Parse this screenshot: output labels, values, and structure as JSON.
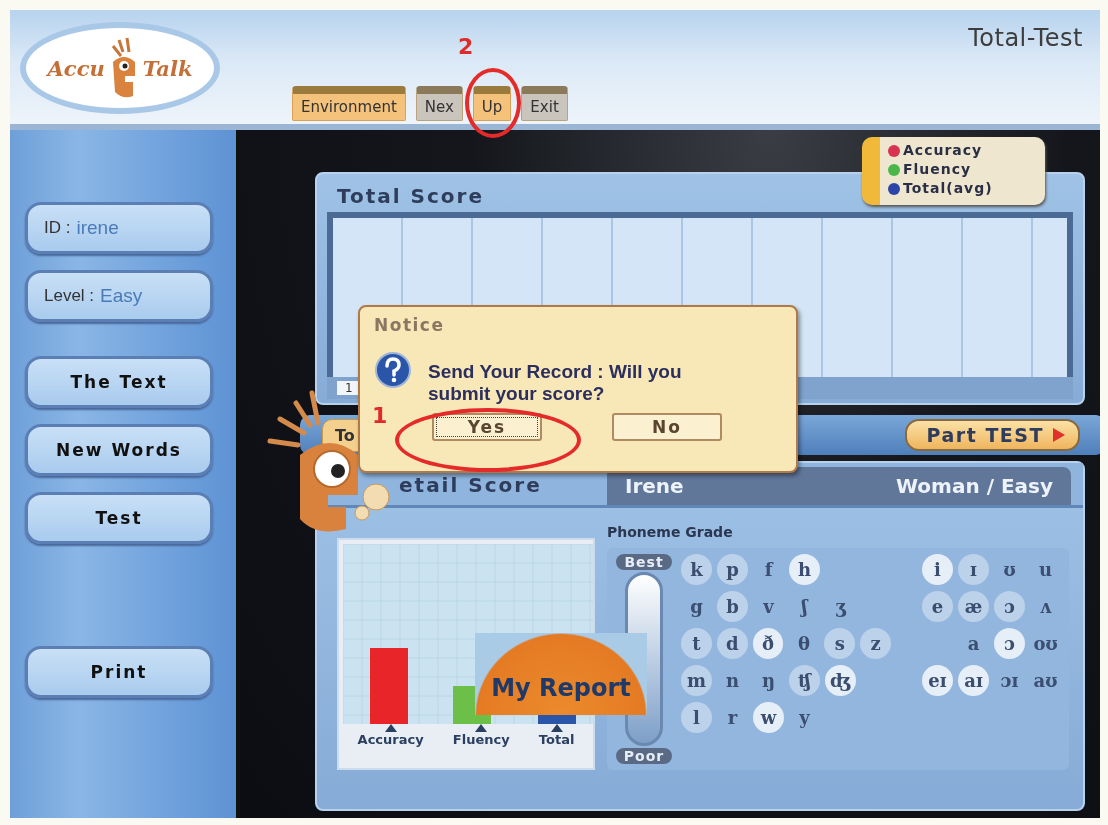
{
  "header": {
    "logo": {
      "left": "Accu",
      "right": "Talk"
    },
    "title": "Total-Test"
  },
  "menu_tabs": [
    {
      "label": "Environment",
      "selected": true
    },
    {
      "label": "Nex",
      "selected": false
    },
    {
      "label": "Up",
      "selected": true
    },
    {
      "label": "Exit",
      "selected": false
    }
  ],
  "sidebar": {
    "fields": [
      {
        "label": "ID :",
        "value": "irene"
      },
      {
        "label": "Level :",
        "value": "Easy"
      }
    ],
    "buttons": [
      "The Text",
      "New Words",
      "Test",
      "Print"
    ]
  },
  "legend": [
    {
      "label": "Accuracy",
      "color": "#d8334f"
    },
    {
      "label": "Fluency",
      "color": "#4cb748"
    },
    {
      "label": "Total(avg)",
      "color": "#2b46a8"
    }
  ],
  "total_score": {
    "title": "Total Score",
    "page": "1"
  },
  "tabs": [
    {
      "label": "To"
    }
  ],
  "part_test_button": "Part TEST",
  "detail": {
    "title": "etail Score",
    "user": "Irene",
    "profile": "Woman / Easy",
    "chart_labels": [
      "Accuracy",
      "Fluency",
      "Total"
    ],
    "phoneme_title": "Phoneme Grade",
    "scale": {
      "top": "Best",
      "bottom": "Poor"
    },
    "consonants": [
      [
        {
          "symbol": "k",
          "color": "#bcd1ea"
        },
        {
          "symbol": "p",
          "color": "#bcd1ea"
        },
        {
          "symbol": "f"
        },
        {
          "symbol": "h",
          "color": "#e6eef8"
        }
      ],
      [
        {
          "symbol": "g"
        },
        {
          "symbol": "b",
          "color": "#bcd1ea"
        },
        {
          "symbol": "v"
        },
        {
          "symbol": "ʃ"
        },
        {
          "symbol": "ʒ"
        }
      ],
      [
        {
          "symbol": "t",
          "color": "#bcd1ea"
        },
        {
          "symbol": "d",
          "color": "#bcd1ea"
        },
        {
          "symbol": "ð",
          "color": "#e6eef8"
        },
        {
          "symbol": "θ"
        },
        {
          "symbol": "s",
          "color": "#bcd1ea"
        },
        {
          "symbol": "z",
          "color": "#bcd1ea"
        }
      ],
      [
        {
          "symbol": "m",
          "color": "#bcd1ea"
        },
        {
          "symbol": "n"
        },
        {
          "symbol": "ŋ"
        },
        {
          "symbol": "ʧ",
          "color": "#bcd1ea"
        },
        {
          "symbol": "ʤ",
          "color": "#e6eef8"
        }
      ],
      [
        {
          "symbol": "l",
          "color": "#bcd1ea"
        },
        {
          "symbol": "r"
        },
        {
          "symbol": "w",
          "color": "#e6eef8"
        },
        {
          "symbol": "y"
        }
      ]
    ],
    "vowels": [
      [
        {
          "symbol": "i",
          "color": "#e6eef8"
        },
        {
          "symbol": "ɪ",
          "color": "#bcd1ea"
        },
        {
          "symbol": "ʊ"
        },
        {
          "symbol": "u"
        }
      ],
      [
        {
          "symbol": "e",
          "color": "#bcd1ea"
        },
        {
          "symbol": "æ",
          "color": "#bcd1ea"
        },
        {
          "symbol": "ɔ",
          "color": "#bcd1ea"
        },
        {
          "symbol": "ʌ"
        }
      ],
      [
        {
          "symbol": "a"
        },
        {
          "symbol": "ɔ",
          "color": "#e6eef8"
        },
        {
          "symbol": "oʊ"
        }
      ],
      [
        {
          "symbol": "eɪ",
          "color": "#e6eef8"
        },
        {
          "symbol": "aɪ",
          "color": "#e6eef8"
        },
        {
          "symbol": "ɔɪ"
        },
        {
          "symbol": "aʊ"
        }
      ]
    ]
  },
  "dialog": {
    "title": "Notice",
    "message": "Send Your Record : Will you submit your score?",
    "buttons": [
      {
        "label": "Yes",
        "selected": true
      },
      {
        "label": "No",
        "selected": false
      }
    ]
  },
  "my_report_button": "My Report",
  "annotations": [
    {
      "label": "1"
    },
    {
      "label": "2"
    }
  ]
}
